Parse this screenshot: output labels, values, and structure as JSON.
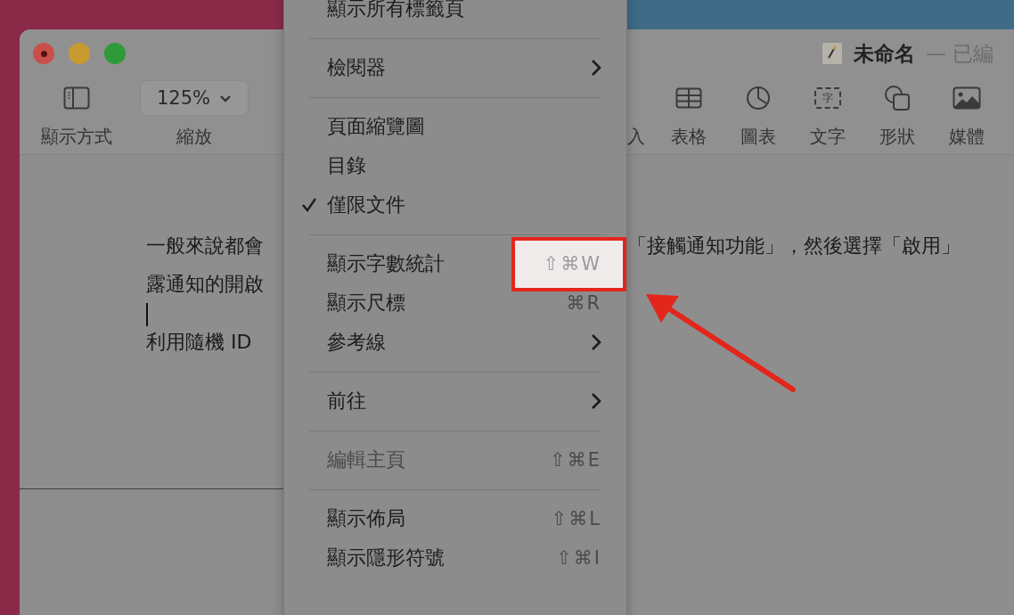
{
  "window": {
    "title": "未命名",
    "title_suffix": "— 已編"
  },
  "toolbar": {
    "left": [
      {
        "kind": "sidebar",
        "label": "顯示方式"
      },
      {
        "kind": "zoom",
        "value": "125%",
        "label": "縮放"
      }
    ],
    "right": [
      {
        "kind": "partial",
        "label": "入"
      },
      {
        "kind": "table",
        "label": "表格"
      },
      {
        "kind": "chart",
        "label": "圖表"
      },
      {
        "kind": "text",
        "label": "文字",
        "badge": "字"
      },
      {
        "kind": "shape",
        "label": "形狀"
      },
      {
        "kind": "media",
        "label": "媒體"
      }
    ]
  },
  "document": {
    "lines": [
      {
        "kind": "text",
        "left": "一般來說都會",
        "right": "「接觸通知功能」，然後選擇「啟用」"
      },
      {
        "kind": "text",
        "left": "露通知的開啟"
      },
      {
        "kind": "cursor"
      },
      {
        "kind": "text",
        "left": "利用隨機 ID"
      }
    ]
  },
  "menu": {
    "groups": [
      [
        {
          "label": "顯示所有標籤頁",
          "kind": "plain",
          "checked": false,
          "disabled": false,
          "highlighted": false
        }
      ],
      [
        {
          "label": "檢閱器",
          "kind": "submenu",
          "checked": false,
          "disabled": false,
          "highlighted": false
        }
      ],
      [
        {
          "label": "頁面縮覽圖",
          "kind": "plain",
          "checked": false,
          "disabled": false,
          "highlighted": false
        },
        {
          "label": "目錄",
          "kind": "plain",
          "checked": false,
          "disabled": false,
          "highlighted": false
        },
        {
          "label": "僅限文件",
          "kind": "plain",
          "checked": true,
          "disabled": false,
          "highlighted": false
        }
      ],
      [
        {
          "label": "顯示字數統計",
          "kind": "shortcut",
          "shortcut": "⇧⌘W",
          "checked": false,
          "disabled": false,
          "highlighted": true
        },
        {
          "label": "顯示尺標",
          "kind": "shortcut",
          "shortcut": "⌘R",
          "checked": false,
          "disabled": false,
          "highlighted": false
        },
        {
          "label": "參考線",
          "kind": "submenu",
          "checked": false,
          "disabled": false,
          "highlighted": false
        }
      ],
      [
        {
          "label": "前往",
          "kind": "submenu",
          "checked": false,
          "disabled": false,
          "highlighted": false
        }
      ],
      [
        {
          "label": "編輯主頁",
          "kind": "shortcut",
          "shortcut": "⇧⌘E",
          "checked": false,
          "disabled": true,
          "highlighted": false
        }
      ],
      [
        {
          "label": "顯示佈局",
          "kind": "shortcut",
          "shortcut": "⇧⌘L",
          "checked": false,
          "disabled": false,
          "highlighted": false
        },
        {
          "label": "顯示隱形符號",
          "kind": "shortcut",
          "shortcut": "⇧⌘I",
          "checked": false,
          "disabled": false,
          "highlighted": false
        }
      ]
    ]
  }
}
